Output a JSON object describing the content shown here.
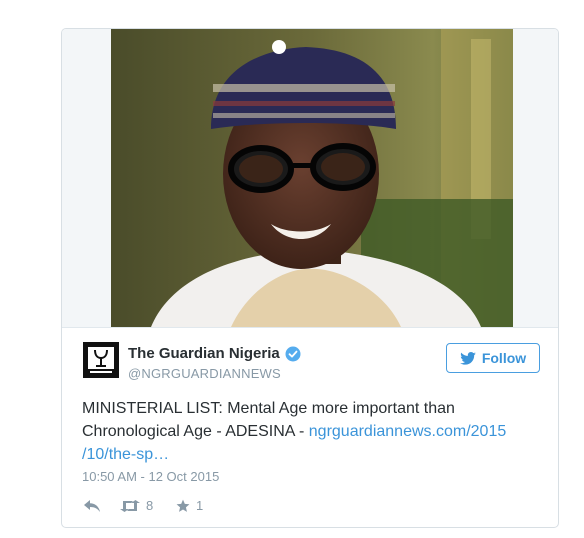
{
  "tweet": {
    "author_name": "The Guardian Nigeria",
    "author_handle": "@NGRGUARDIANNEWS",
    "follow_label": "Follow",
    "text": "MINISTERIAL LIST: Mental Age more important than Chronological Age - ADESINA - ",
    "link_text_line1": "ngrguardiannews.com/2015",
    "link_text_line2": "/10/the-sp…",
    "timestamp": "10:50 AM - 12 Oct 2015",
    "retweet_count": "8",
    "like_count": "1"
  },
  "icons": {
    "verified": "verified-badge-icon",
    "twitter_bird": "twitter-bird-icon",
    "reply": "reply-icon",
    "retweet": "retweet-icon",
    "favorite": "star-icon"
  },
  "colors": {
    "link": "#3b94d9",
    "text": "#292f33",
    "muted": "#8899a6",
    "verified": "#55acee",
    "border": "#d8dfe4"
  }
}
